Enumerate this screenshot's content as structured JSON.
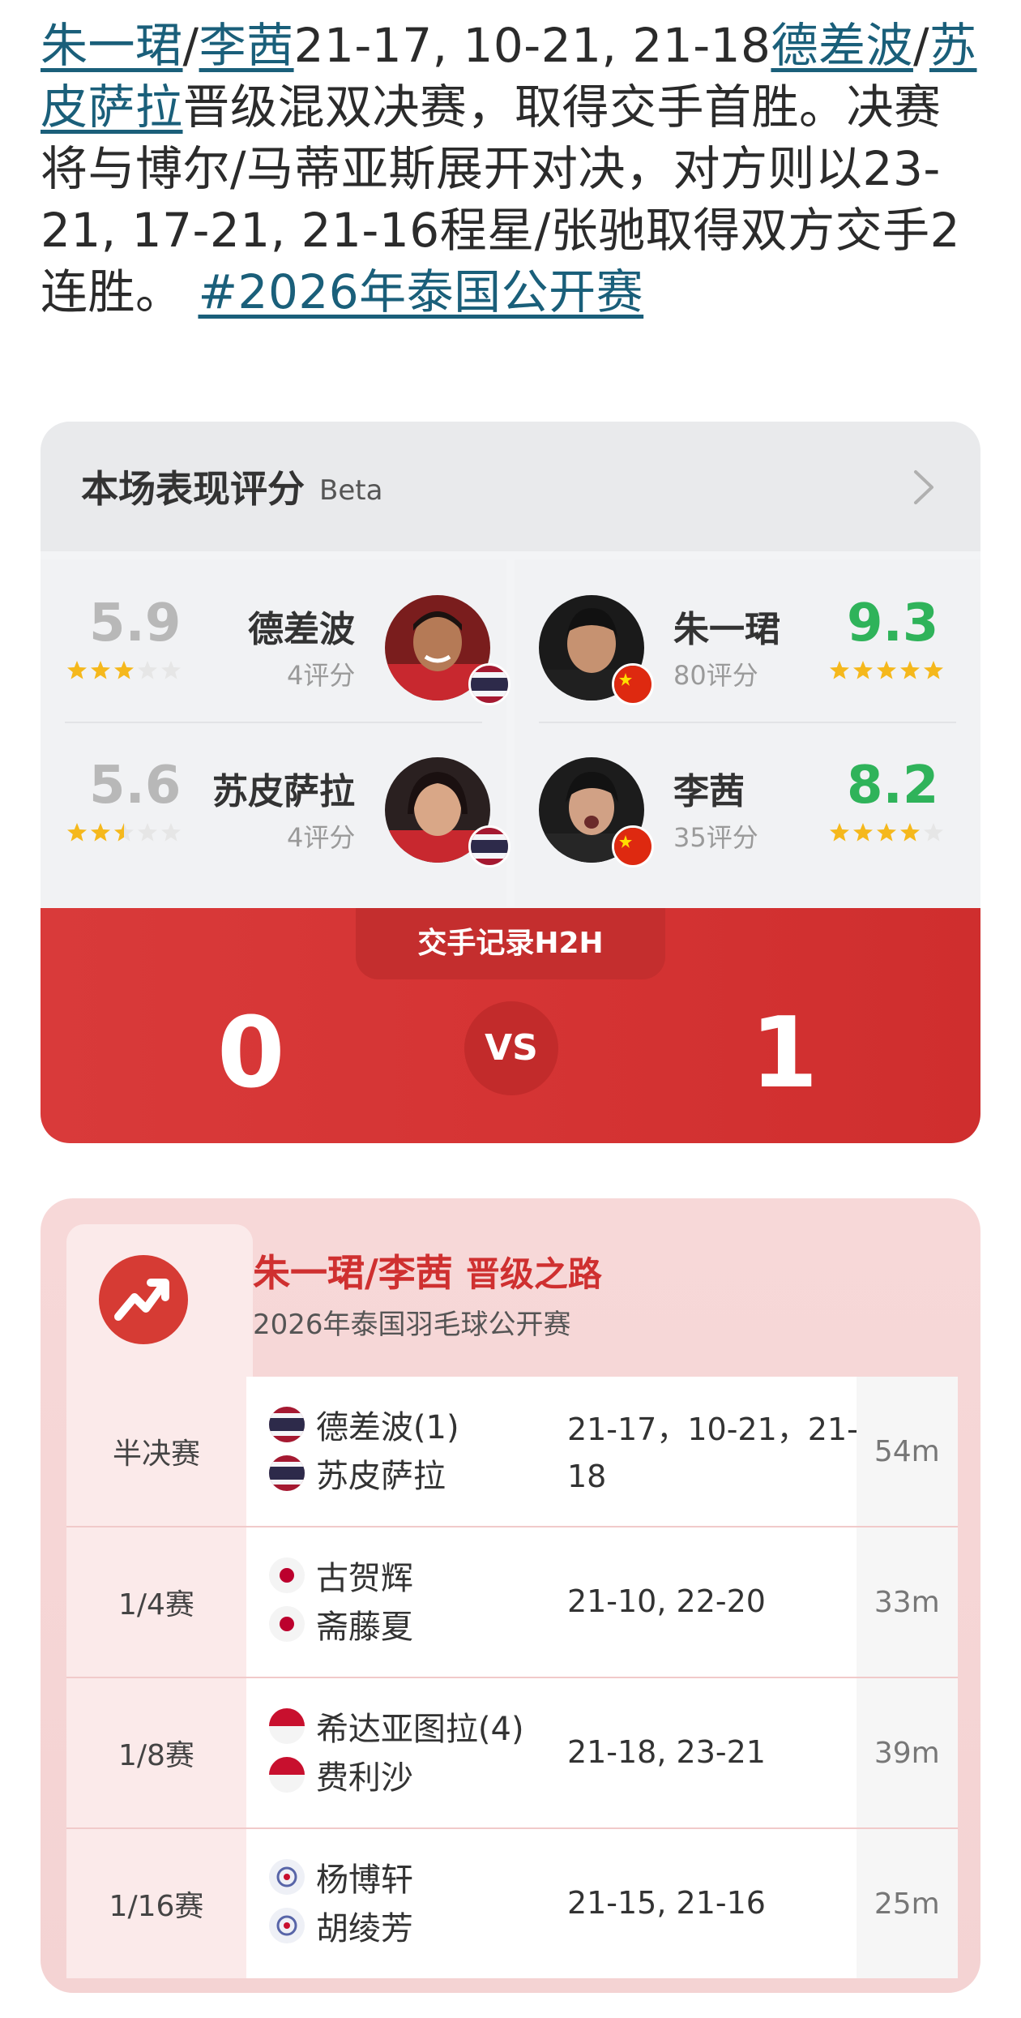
{
  "article": {
    "p1": "朱一珺",
    "sep1": "/",
    "p2": "李茜",
    "scores": "21-17, 10-21, 21-18",
    "p3": "德差波",
    "sep2": "/",
    "p4": "苏皮萨拉",
    "text": "晋级混双决赛，取得交手首胜。决赛将与博尔/马蒂亚斯展开对决，对方则以23-21, 17-21, 21-16程星/张驰取得双方交手2连胜。",
    "hashtag": "#2026年泰国公开赛"
  },
  "rating": {
    "title": "本场表现评分",
    "beta": "Beta",
    "left_team": [
      {
        "score": "5.9",
        "name": "德差波",
        "count": "4评分",
        "stars": 3,
        "flag": "thailand"
      },
      {
        "score": "5.6",
        "name": "苏皮萨拉",
        "count": "4评分",
        "stars": 2.5,
        "flag": "thailand"
      }
    ],
    "right_team": [
      {
        "score": "9.3",
        "name": "朱一珺",
        "count": "80评分",
        "stars": 5,
        "flag": "china"
      },
      {
        "score": "8.2",
        "name": "李茜",
        "count": "35评分",
        "stars": 4,
        "flag": "china"
      }
    ],
    "h2h_label": "交手记录H2H",
    "h2h_left": "0",
    "vs": "VS",
    "h2h_right": "1"
  },
  "road": {
    "title": "朱一珺/李茜",
    "title_suffix": "晋级之路",
    "subtitle": "2026年泰国羽毛球公开赛",
    "logo_icon": "trending-up-icon",
    "rows": [
      {
        "round": "半决赛",
        "opp1": "德差波(1)",
        "opp2": "苏皮萨拉",
        "flag": "thailand",
        "score": "21-17，10-21，21-18",
        "duration": "54m"
      },
      {
        "round": "1/4赛",
        "opp1": "古贺辉",
        "opp2": "斋藤夏",
        "flag": "japan",
        "score": "21-10, 22-20",
        "duration": "33m"
      },
      {
        "round": "1/8赛",
        "opp1": "希达亚图拉(4)",
        "opp2": "费利沙",
        "flag": "indonesia",
        "score": "21-18, 23-21",
        "duration": "39m"
      },
      {
        "round": "1/16赛",
        "opp1": "杨博轩",
        "opp2": "胡绫芳",
        "flag": "chinese-taipei",
        "score": "21-15, 21-16",
        "duration": "25m"
      }
    ]
  },
  "colors": {
    "link": "#1a5f7a",
    "good_score": "#2fb35a",
    "low_score": "#b8b8b8",
    "star": "#f5b81c",
    "h2h_red": "#d53434",
    "road_title_red": "#cf3030"
  }
}
